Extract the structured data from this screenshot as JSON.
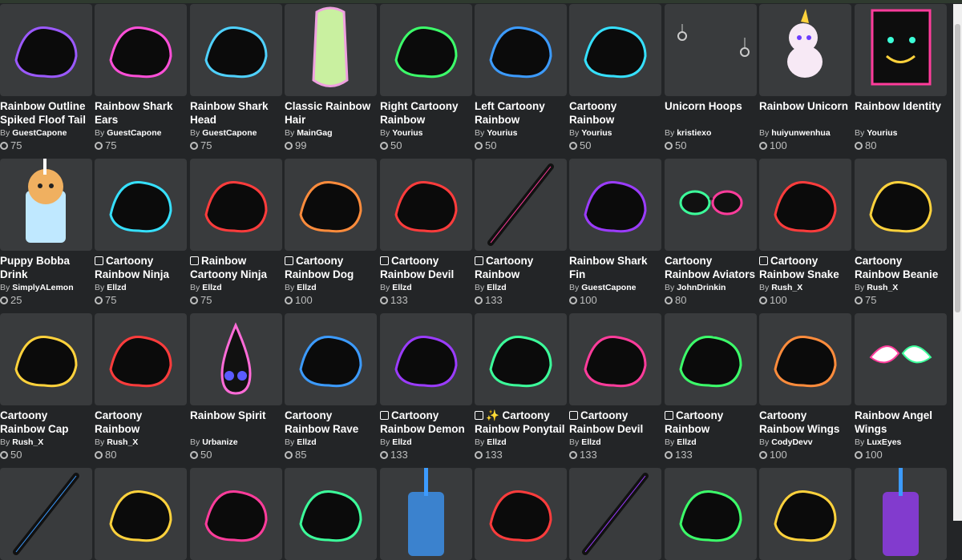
{
  "rows": [
    [
      {
        "name1": "Rainbow Outline",
        "name2": "Spiked Floof Tail",
        "limited": false,
        "creator": "GuestCapone",
        "price": "75",
        "icon": "floof-tail-icon",
        "color": "#9b59ff"
      },
      {
        "name1": "Rainbow Shark",
        "name2": "Ears",
        "limited": false,
        "creator": "GuestCapone",
        "price": "75",
        "icon": "shark-ears-icon",
        "color": "#ff4fd8"
      },
      {
        "name1": "Rainbow Shark",
        "name2": "Head",
        "limited": false,
        "creator": "GuestCapone",
        "price": "75",
        "icon": "shark-head-icon",
        "color": "#4fd1ff"
      },
      {
        "name1": "Classic Rainbow",
        "name2": "Hair",
        "limited": false,
        "creator": "MainGag",
        "price": "99",
        "icon": "rainbow-hair-icon",
        "color": "#c8f090"
      },
      {
        "name1": "Right Cartoony",
        "name2": "Rainbow",
        "limited": false,
        "creator": "Yourius",
        "price": "50",
        "icon": "horn-right-icon",
        "color": "#3cff6a"
      },
      {
        "name1": "Left Cartoony",
        "name2": "Rainbow",
        "limited": false,
        "creator": "Yourius",
        "price": "50",
        "icon": "horn-left-icon",
        "color": "#3c9bff"
      },
      {
        "name1": "Cartoony",
        "name2": "Rainbow",
        "limited": false,
        "creator": "Yourius",
        "price": "50",
        "icon": "bandana-icon",
        "color": "#36e0ff"
      },
      {
        "name1": "Unicorn Hoops",
        "name2": "",
        "limited": false,
        "creator": "kristiexo",
        "price": "50",
        "icon": "hoops-icon",
        "color": "#cccccc"
      },
      {
        "name1": "Rainbow Unicorn",
        "name2": "",
        "limited": false,
        "creator": "huiyunwenhua",
        "price": "100",
        "icon": "unicorn-icon",
        "color": "#ffffff"
      },
      {
        "name1": "Rainbow Identity",
        "name2": "",
        "limited": false,
        "creator": "Yourius",
        "price": "80",
        "icon": "identity-face-icon",
        "color": "#ff3c9b"
      }
    ],
    [
      {
        "name1": "Puppy Bobba",
        "name2": "Drink",
        "limited": false,
        "creator": "SimplyALemon",
        "price": "25",
        "icon": "puppy-drink-icon",
        "color": "#f0b060"
      },
      {
        "name1": "Cartoony",
        "name2": "Rainbow Ninja",
        "limited": true,
        "creator": "Ellzd",
        "price": "75",
        "icon": "ninja-mask-icon",
        "color": "#36e0ff"
      },
      {
        "name1": "Rainbow",
        "name2": "Cartoony Ninja",
        "limited": true,
        "creator": "Ellzd",
        "price": "75",
        "icon": "ninja-band-icon",
        "color": "#ff3c3c"
      },
      {
        "name1": "Cartoony",
        "name2": "Rainbow Dog",
        "limited": true,
        "creator": "Ellzd",
        "price": "100",
        "icon": "dog-ears-icon",
        "color": "#ff8c3c"
      },
      {
        "name1": "Cartoony",
        "name2": "Rainbow Devil",
        "limited": true,
        "creator": "Ellzd",
        "price": "133",
        "icon": "devil-wings-icon",
        "color": "#ff3c3c"
      },
      {
        "name1": "Cartoony",
        "name2": "Rainbow",
        "limited": true,
        "creator": "Ellzd",
        "price": "133",
        "icon": "sword-icon",
        "color": "#ff3c9b"
      },
      {
        "name1": "Rainbow Shark",
        "name2": "Fin",
        "limited": false,
        "creator": "GuestCapone",
        "price": "100",
        "icon": "shark-fin-icon",
        "color": "#9b3cff"
      },
      {
        "name1": "Cartoony",
        "name2": "Rainbow Aviators",
        "limited": false,
        "creator": "JohnDrinkin",
        "price": "80",
        "icon": "aviators-icon",
        "color": "#3cff9b"
      },
      {
        "name1": "Cartoony",
        "name2": "Rainbow Snake",
        "limited": true,
        "creator": "Rush_X",
        "price": "100",
        "icon": "snake-icon",
        "color": "#ff3c3c"
      },
      {
        "name1": "Cartoony",
        "name2": "Rainbow Beanie",
        "limited": false,
        "creator": "Rush_X",
        "price": "75",
        "icon": "beanie-icon",
        "color": "#ffd23c"
      }
    ],
    [
      {
        "name1": "Cartoony",
        "name2": "Rainbow Cap",
        "limited": false,
        "creator": "Rush_X",
        "price": "50",
        "icon": "cap-icon",
        "color": "#ffd23c"
      },
      {
        "name1": "Cartoony",
        "name2": "Rainbow",
        "limited": false,
        "creator": "Rush_X",
        "price": "80",
        "icon": "shoulder-pads-icon",
        "color": "#ff3c3c"
      },
      {
        "name1": "Rainbow Spirit",
        "name2": "",
        "limited": false,
        "creator": "Urbanize",
        "price": "50",
        "icon": "spirit-icon",
        "color": "#ff6bd8"
      },
      {
        "name1": "Cartoony",
        "name2": "Rainbow Rave",
        "limited": false,
        "creator": "Ellzd",
        "price": "85",
        "icon": "headphones-icon",
        "color": "#3c9bff"
      },
      {
        "name1": "Cartoony",
        "name2": "Rainbow Demon",
        "limited": true,
        "creator": "Ellzd",
        "price": "133",
        "icon": "demon-icon",
        "color": "#9b3cff"
      },
      {
        "name1": "✨ Cartoony",
        "name2": "Rainbow Ponytail",
        "limited": true,
        "creator": "Ellzd",
        "price": "133",
        "icon": "ponytail-icon",
        "color": "#3cff9b"
      },
      {
        "name1": "Cartoony",
        "name2": "Rainbow Devil",
        "limited": true,
        "creator": "Ellzd",
        "price": "133",
        "icon": "bat-wings-icon",
        "color": "#ff3c9b"
      },
      {
        "name1": "Cartoony",
        "name2": "Rainbow",
        "limited": true,
        "creator": "Ellzd",
        "price": "133",
        "icon": "butterfly-wings-icon",
        "color": "#3cff6a"
      },
      {
        "name1": "Cartoony",
        "name2": "Rainbow Wings",
        "limited": false,
        "creator": "CodyDevv",
        "price": "100",
        "icon": "small-wings-icon",
        "color": "#ff8c3c"
      },
      {
        "name1": "Rainbow Angel",
        "name2": "Wings",
        "limited": false,
        "creator": "LuxEyes",
        "price": "100",
        "icon": "angel-wings-icon",
        "color": "#ffffff"
      }
    ],
    [
      {
        "icon": "dark-sword-icon",
        "color": "#3c9bff"
      },
      {
        "icon": "rainbow-horns-icon",
        "color": "#ffd23c"
      },
      {
        "icon": "bunny-ears-icon",
        "color": "#ff3c9b"
      },
      {
        "icon": "jacket-icon",
        "color": "#3cff9b"
      },
      {
        "icon": "blue-drink-icon",
        "color": "#3c9bff"
      },
      {
        "icon": "tail-icon",
        "color": "#ff3c3c"
      },
      {
        "icon": "dark-blade-icon",
        "color": "#9b3cff"
      },
      {
        "icon": "cane-icon",
        "color": "#3cff6a"
      },
      {
        "icon": "bowl-icon",
        "color": "#ffd23c"
      },
      {
        "icon": "purple-drink-icon",
        "color": "#9b3cff"
      }
    ]
  ],
  "by_label": "By"
}
